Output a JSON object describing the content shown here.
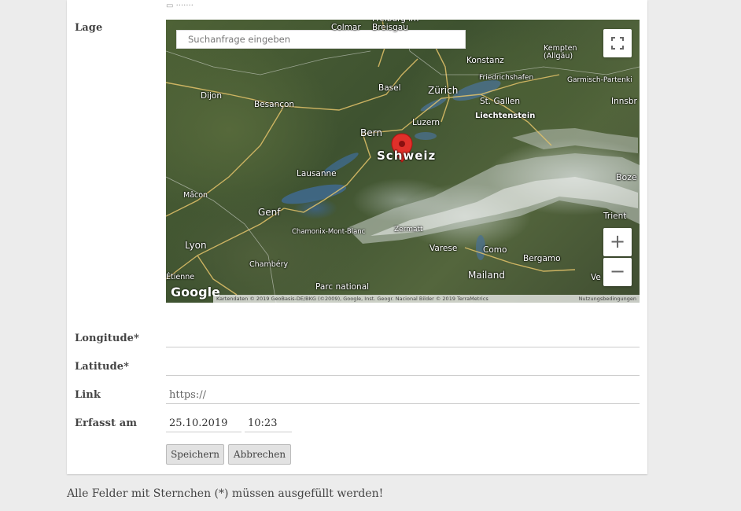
{
  "form": {
    "lage_label": "Lage",
    "longitude_label": "Longitude*",
    "latitude_label": "Latitude*",
    "link_label": "Link",
    "link_placeholder": "https://",
    "erfasst_label": "Erfasst am",
    "date_value": "25.10.2019",
    "time_value": "10:23",
    "save_button": "Speichern",
    "cancel_button": "Abbrechen"
  },
  "map": {
    "search_placeholder": "Suchanfrage eingeben",
    "country_label": "Schweiz",
    "zoom_in": "+",
    "zoom_out": "−",
    "google_logo": "Google",
    "attribution": "Kartendaten © 2019 GeoBasis-DE/BKG (©2009), Google, Inst. Geogr. Nacional Bilder © 2019 TerraMetrics",
    "terms": "Nutzungsbedingungen",
    "cities": {
      "colmar": "Colmar",
      "freiburg": "Freiburg im Breisgau",
      "konstanz": "Konstanz",
      "kempten": "Kempten (Allgäu)",
      "friedrichshafen": "Friedrichshafen",
      "garmisch": "Garmisch-Partenki",
      "innsbruck": "Innsbr",
      "basel": "Basel",
      "zurich": "Zürich",
      "stgallen": "St. Gallen",
      "liechtenstein": "Liechtenstein",
      "dijon": "Dijon",
      "besancon": "Besançon",
      "bern": "Bern",
      "luzern": "Luzern",
      "lausanne": "Lausanne",
      "bolzano": "Boze",
      "macon": "Mâcon",
      "genf": "Genf",
      "chamonix": "Chamonix-Mont-Blanc",
      "zermatt": "Zermatt",
      "trient": "Trient",
      "lyon": "Lyon",
      "chambery": "Chambéry",
      "varese": "Varese",
      "como": "Como",
      "bergamo": "Bergamo",
      "mailand": "Mailand",
      "etienne": "Étienne",
      "parc": "Parc national",
      "vr": "Ve"
    }
  },
  "footer": {
    "note": "Alle Felder mit Sternchen (*) müssen ausgefüllt werden!"
  }
}
